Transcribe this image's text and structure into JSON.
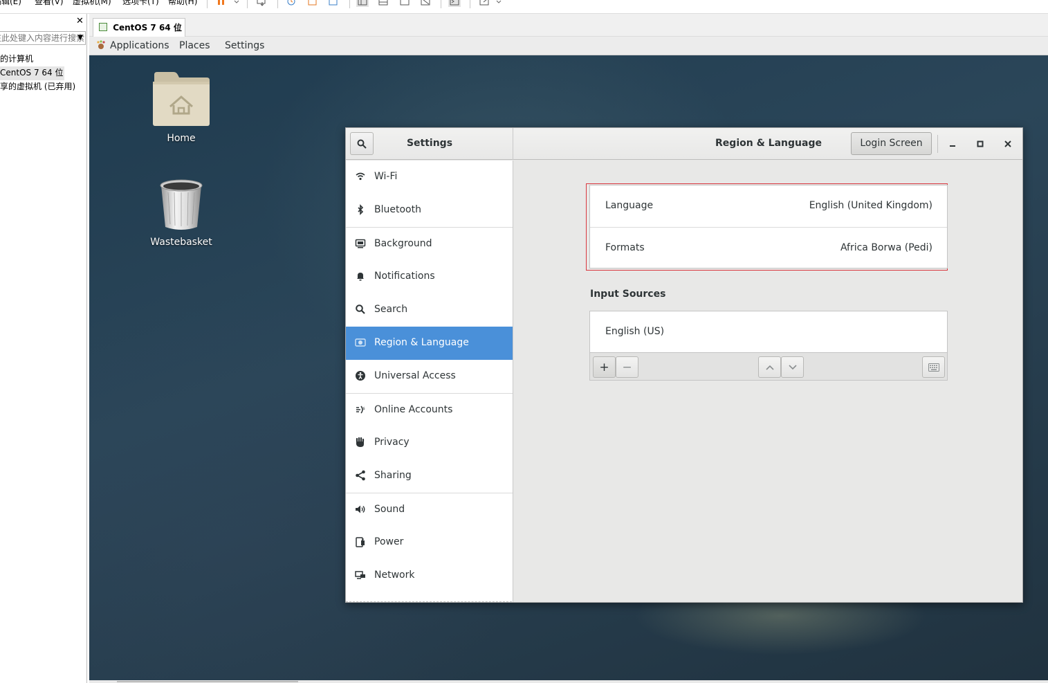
{
  "host": {
    "menu": [
      "编辑(E)",
      "查看(V)",
      "虚拟机(M)",
      "选项卡(T)",
      "帮助(H)"
    ]
  },
  "library": {
    "close_glyph": "✕",
    "search_placeholder": "在此处键入内容进行搜索",
    "tree": [
      "我的计算机",
      "CentOS 7 64 位",
      "共享的虚拟机 (已弃用)"
    ]
  },
  "vm_tab": {
    "label": "CentOS 7 64 位",
    "close_glyph": "✕"
  },
  "gnome_panel": {
    "applications": "Applications",
    "places": "Places",
    "settings": "Settings"
  },
  "desktop": {
    "icons": [
      {
        "label": "Home",
        "icon": "home-folder-icon"
      },
      {
        "label": "Wastebasket",
        "icon": "trash-icon"
      }
    ]
  },
  "settings_window": {
    "sidebar_title": "Settings",
    "page_title": "Region & Language",
    "login_screen_button": "Login Screen",
    "sidebar_items": [
      {
        "label": "Wi-Fi",
        "icon": "wifi-icon",
        "active": false
      },
      {
        "label": "Bluetooth",
        "icon": "bluetooth-icon",
        "active": false
      },
      {
        "label": "Background",
        "icon": "background-icon",
        "active": false
      },
      {
        "label": "Notifications",
        "icon": "bell-icon",
        "active": false
      },
      {
        "label": "Search",
        "icon": "search-icon",
        "active": false
      },
      {
        "label": "Region & Language",
        "icon": "region-icon",
        "active": true
      },
      {
        "label": "Universal Access",
        "icon": "accessibility-icon",
        "active": false
      },
      {
        "label": "Online Accounts",
        "icon": "online-accounts-icon",
        "active": false
      },
      {
        "label": "Privacy",
        "icon": "hand-icon",
        "active": false
      },
      {
        "label": "Sharing",
        "icon": "share-icon",
        "active": false
      },
      {
        "label": "Sound",
        "icon": "speaker-icon",
        "active": false
      },
      {
        "label": "Power",
        "icon": "power-icon",
        "active": false
      },
      {
        "label": "Network",
        "icon": "network-icon",
        "active": false
      }
    ],
    "language": {
      "label": "Language",
      "value": "English (United Kingdom)"
    },
    "formats": {
      "label": "Formats",
      "value": "Africa Borwa (Pedi)"
    },
    "input_sources_title": "Input Sources",
    "input_sources": [
      "English (US)"
    ],
    "toolbar": {
      "add": "+",
      "remove": "−"
    }
  },
  "colors": {
    "accent": "#4a90d9",
    "highlight_frame": "#d9363e",
    "pause_icon": "#f0781e"
  }
}
